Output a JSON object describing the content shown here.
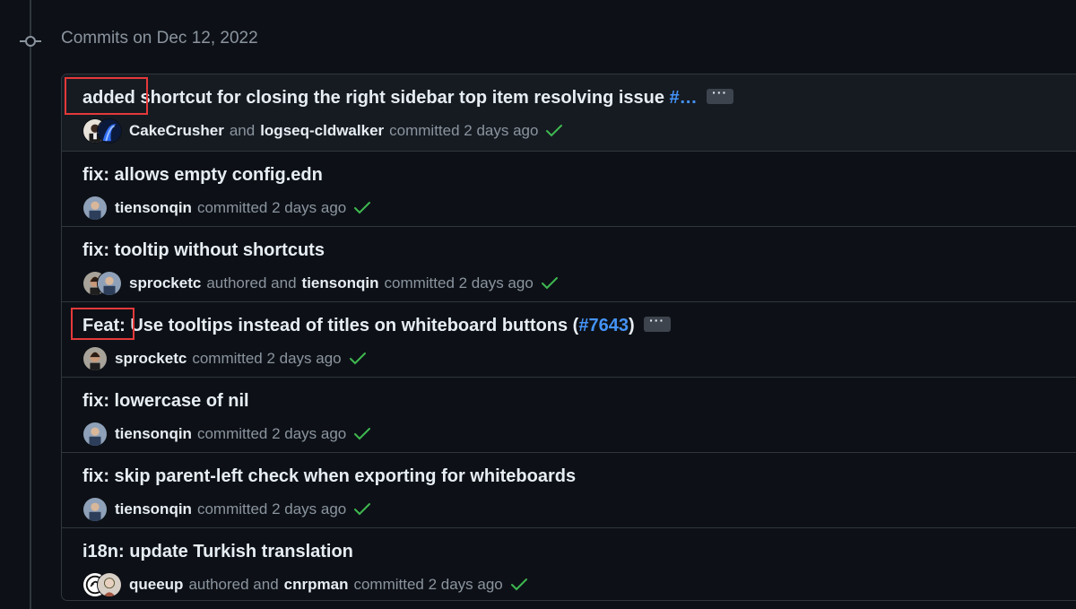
{
  "group": {
    "title": "Commits on Dec 12, 2022"
  },
  "commits": [
    {
      "message": "added shortcut for closing the right sidebar top item resolving issue ",
      "link": "#…",
      "has_ellipsis": true,
      "ellipsis_label": "···",
      "avatars": [
        "avatar-cakecrusher",
        "avatar-logseq-cldwalker"
      ],
      "meta": [
        {
          "type": "user",
          "text": "CakeCrusher"
        },
        {
          "type": "text",
          "text": "and"
        },
        {
          "type": "user",
          "text": "logseq-cldwalker"
        },
        {
          "type": "text",
          "text": "committed 2 days ago"
        }
      ],
      "status_icon": "check-icon"
    },
    {
      "message": "fix: allows empty config.edn",
      "avatars": [
        "avatar-tiensonqin"
      ],
      "meta": [
        {
          "type": "user",
          "text": "tiensonqin"
        },
        {
          "type": "text",
          "text": "committed 2 days ago"
        }
      ],
      "status_icon": "check-icon"
    },
    {
      "message": "fix: tooltip without shortcuts",
      "avatars": [
        "avatar-sprocketc",
        "avatar-tiensonqin"
      ],
      "meta": [
        {
          "type": "user",
          "text": "sprocketc"
        },
        {
          "type": "text",
          "text": "authored and"
        },
        {
          "type": "user",
          "text": "tiensonqin"
        },
        {
          "type": "text",
          "text": "committed 2 days ago"
        }
      ],
      "status_icon": "check-icon"
    },
    {
      "message": "Feat: Use tooltips instead of titles on whiteboard buttons (",
      "link": "#7643",
      "message_suffix": ")",
      "has_ellipsis": true,
      "ellipsis_label": "···",
      "avatars": [
        "avatar-sprocketc"
      ],
      "meta": [
        {
          "type": "user",
          "text": "sprocketc"
        },
        {
          "type": "text",
          "text": "committed 2 days ago"
        }
      ],
      "status_icon": "check-icon"
    },
    {
      "message": "fix: lowercase of nil",
      "avatars": [
        "avatar-tiensonqin"
      ],
      "meta": [
        {
          "type": "user",
          "text": "tiensonqin"
        },
        {
          "type": "text",
          "text": "committed 2 days ago"
        }
      ],
      "status_icon": "check-icon"
    },
    {
      "message": "fix: skip parent-left check when exporting for whiteboards",
      "avatars": [
        "avatar-tiensonqin"
      ],
      "meta": [
        {
          "type": "user",
          "text": "tiensonqin"
        },
        {
          "type": "text",
          "text": "committed 2 days ago"
        }
      ],
      "status_icon": "check-icon"
    },
    {
      "message": "i18n: update Turkish translation",
      "avatars": [
        "avatar-queeup",
        "avatar-cnrpman"
      ],
      "meta": [
        {
          "type": "user",
          "text": "queeup"
        },
        {
          "type": "text",
          "text": "authored and"
        },
        {
          "type": "user",
          "text": "cnrpman"
        },
        {
          "type": "text",
          "text": "committed 2 days ago"
        }
      ],
      "status_icon": "check-icon"
    }
  ],
  "colors": {
    "background": "#0d1117",
    "row_highlight": "#161b22",
    "border": "#30363d",
    "link": "#4493f8",
    "muted": "#8b949e",
    "success": "#3fb950",
    "annotation": "#e5393a"
  }
}
